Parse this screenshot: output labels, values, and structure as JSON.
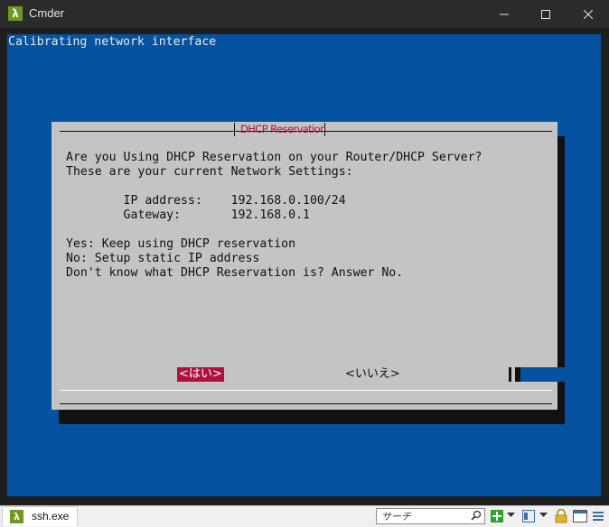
{
  "window": {
    "title": "Cmder",
    "app_icon_glyph": "λ"
  },
  "terminal": {
    "first_line": "Calibrating network interface",
    "background": "#0553a0"
  },
  "dialog": {
    "title": "DHCP Reservation",
    "lines": {
      "question": "Are you Using DHCP Reservation on your Router/DHCP Server?",
      "settings": "These are your current Network Settings:",
      "ip": "        IP address:    192.168.0.100/24",
      "gateway": "        Gateway:       192.168.0.1",
      "yes": "Yes: Keep using DHCP reservation",
      "no": "No: Setup static IP address",
      "dontknow": "Don't know what DHCP Reservation is? Answer No."
    },
    "yes_button": "<はい>",
    "no_button": "<いいえ>",
    "accent": "#b0103d"
  },
  "statusbar": {
    "tab_label": "ssh.exe",
    "tab_icon_glyph": "λ",
    "search_placeholder": "サーチ"
  }
}
